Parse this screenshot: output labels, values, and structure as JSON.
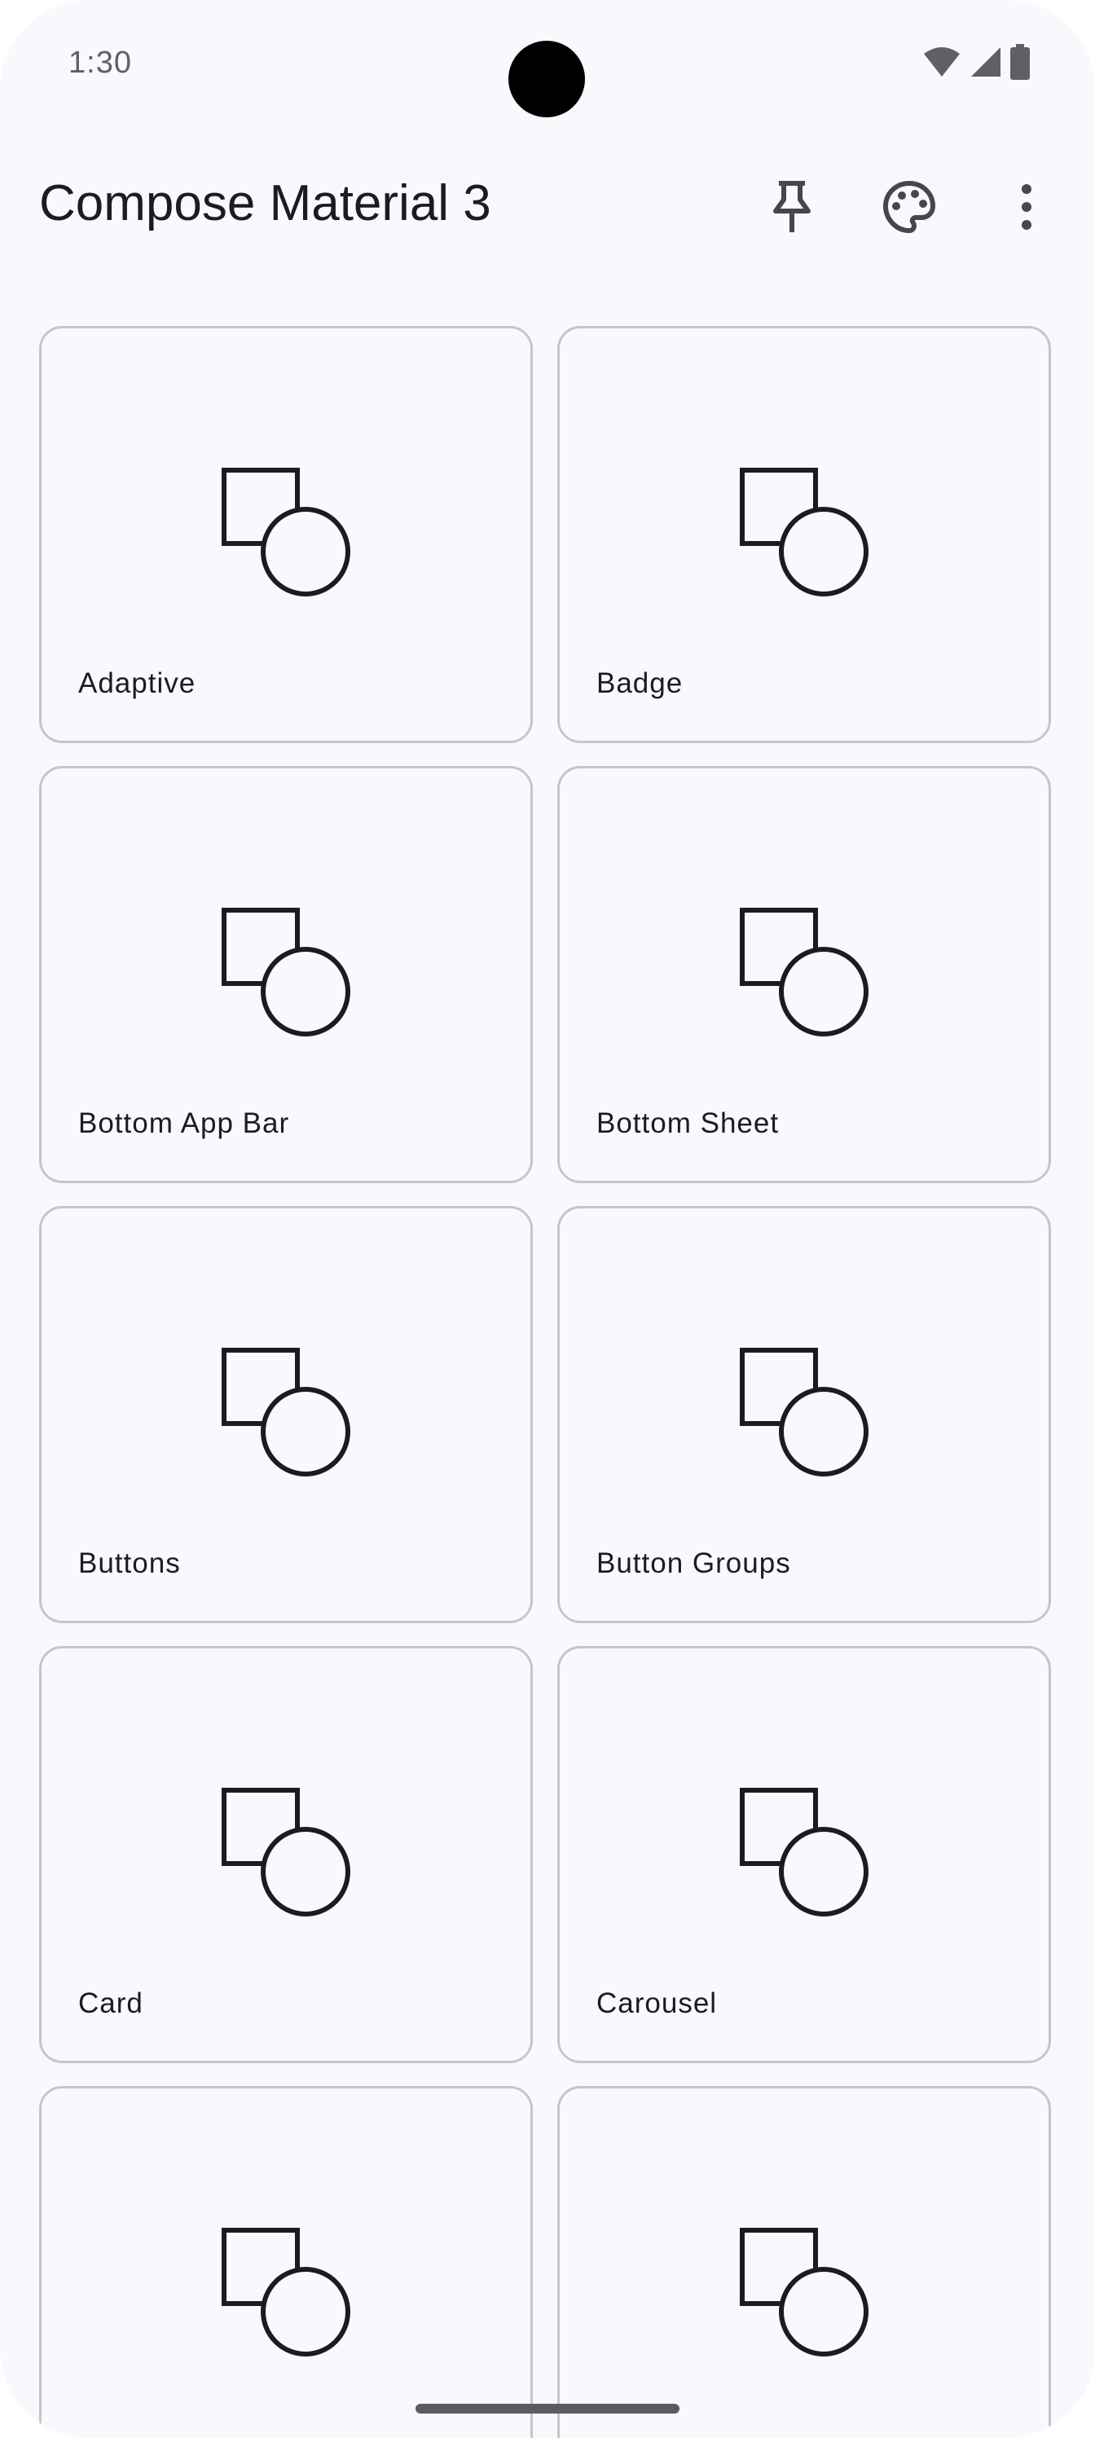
{
  "status_bar": {
    "time": "1:30",
    "icons": [
      "wifi-icon",
      "signal-icon",
      "battery-icon"
    ]
  },
  "top_bar": {
    "title": "Compose Material 3",
    "actions": [
      "pin-icon",
      "palette-icon",
      "more-vert-icon"
    ]
  },
  "components": [
    {
      "label": "Adaptive",
      "icon": "shapes-icon"
    },
    {
      "label": "Badge",
      "icon": "shapes-icon"
    },
    {
      "label": "Bottom App Bar",
      "icon": "shapes-icon"
    },
    {
      "label": "Bottom Sheet",
      "icon": "shapes-icon"
    },
    {
      "label": "Buttons",
      "icon": "shapes-icon"
    },
    {
      "label": "Button Groups",
      "icon": "shapes-icon"
    },
    {
      "label": "Card",
      "icon": "shapes-icon"
    },
    {
      "label": "Carousel",
      "icon": "shapes-icon"
    },
    {
      "label": "",
      "icon": "shapes-icon"
    },
    {
      "label": "",
      "icon": "shapes-icon"
    }
  ],
  "colors": {
    "background": "#f8f8fd",
    "card_border": "#c6c5cf",
    "on_surface": "#1b1b21",
    "status_text": "#5f5f66"
  }
}
